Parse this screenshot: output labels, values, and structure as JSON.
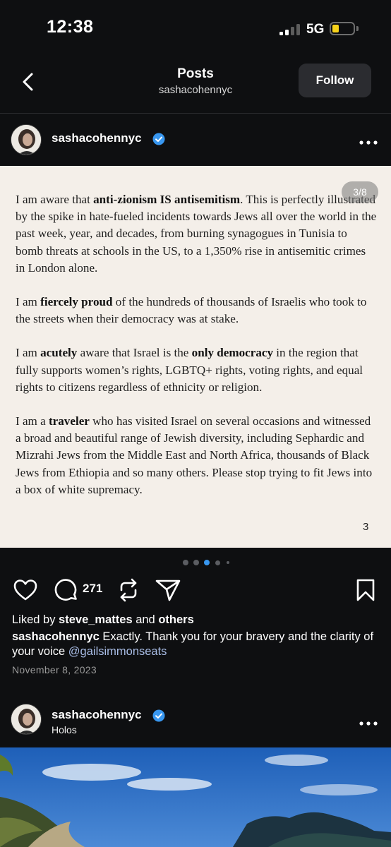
{
  "status_bar": {
    "time": "12:38",
    "network": "5G"
  },
  "nav": {
    "title": "Posts",
    "subtitle": "sashacohennyc",
    "follow_label": "Follow"
  },
  "post1": {
    "username": "sashacohennyc",
    "slide_counter": "3/8",
    "page_number": "3",
    "paragraphs": [
      [
        {
          "t": "I am aware that "
        },
        {
          "t": "anti-zionism IS antisemitism",
          "b": true
        },
        {
          "t": ". This is perfectly illustrated by the spike in hate-fueled incidents towards Jews all over the world in the past week, year, and decades, from burning synagogues in Tunisia to bomb threats at schools in the US, to a 1,350% rise in antisemitic crimes in London alone."
        }
      ],
      [
        {
          "t": "I am "
        },
        {
          "t": "fiercely proud",
          "b": true
        },
        {
          "t": " of the hundreds of thousands of Israelis who took to the streets when their democracy was at stake."
        }
      ],
      [
        {
          "t": "I am "
        },
        {
          "t": "acutely",
          "b": true
        },
        {
          "t": " aware that Israel is the "
        },
        {
          "t": "only democracy",
          "b": true
        },
        {
          "t": " in the region that fully supports women’s rights, LGBTQ+ rights, voting rights, and equal rights to citizens regardless of ethnicity or religion."
        }
      ],
      [
        {
          "t": "I am a "
        },
        {
          "t": "traveler",
          "b": true
        },
        {
          "t": " who has visited Israel on several occasions and witnessed a broad and beautiful range of Jewish diversity, including Sephardic and Mizrahi Jews from the Middle East and North Africa, thousands of Black Jews from Ethiopia and so many others. Please stop trying to fit Jews into a box of white supremacy."
        }
      ]
    ],
    "comment_count": "271",
    "liked_by_prefix": "Liked by ",
    "liked_by_user": "steve_mattes",
    "liked_by_and": " and ",
    "liked_by_others": "others",
    "caption_user": "sashacohennyc",
    "caption_text": " Exactly. Thank you for your bravery and the clarity of your voice ",
    "caption_mention": "@gailsimmonseats",
    "date": "November 8, 2023",
    "carousel": {
      "total_dots": 5,
      "active_index": 2
    }
  },
  "post2": {
    "username": "sashacohennyc",
    "location": "Holos"
  },
  "colors": {
    "background": "#0e0f11",
    "verified": "#3897f0",
    "battery": "#f7d21a",
    "mention": "#a9bde6",
    "slide_bg": "#f4efe9",
    "active_dot": "#3897f0"
  }
}
